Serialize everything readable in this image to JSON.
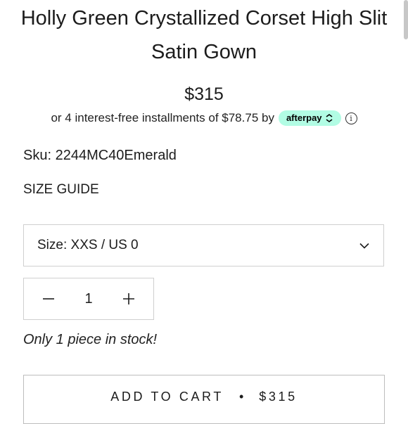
{
  "product": {
    "title": "Holly Green Crystallized Corset High Slit Satin Gown",
    "price": "$315",
    "sku": "Sku: 2244MC40Emerald"
  },
  "afterpay": {
    "text": "or 4 interest-free installments of $78.75 by",
    "badge_label": "afterpay",
    "info_glyph": "i",
    "badge_color": "#b2fce4"
  },
  "links": {
    "size_guide": "SIZE GUIDE"
  },
  "size_select": {
    "label": "Size: XXS / US 0",
    "icon": "chevron-down-icon"
  },
  "quantity": {
    "value": "1",
    "decrement_icon": "minus-icon",
    "increment_icon": "plus-icon"
  },
  "stock": {
    "message": "Only 1 piece in stock!"
  },
  "cart": {
    "label": "ADD TO CART",
    "separator": "•",
    "price": "$315"
  }
}
